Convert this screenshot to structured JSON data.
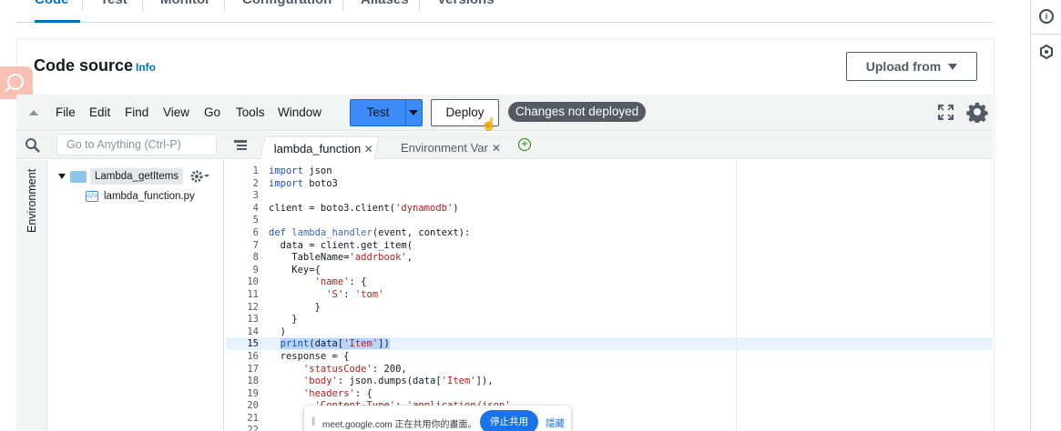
{
  "top_tabs": [
    "Code",
    "Test",
    "Monitor",
    "Configuration",
    "Aliases",
    "Versions"
  ],
  "header": {
    "title": "Code source",
    "info_link": "Info",
    "upload_label": "Upload from"
  },
  "ide": {
    "menu": [
      "File",
      "Edit",
      "Find",
      "View",
      "Go",
      "Tools",
      "Window"
    ],
    "test_label": "Test",
    "deploy_label": "Deploy",
    "status_badge": "Changes not deployed",
    "go_to_placeholder": "Go to Anything (Ctrl-P)",
    "environment_label": "Environment",
    "folder_name": "Lambda_getItems",
    "file_name": "lambda_function.py",
    "tabs": [
      {
        "label": "lambda_function",
        "active": true
      },
      {
        "label": "Environment Var",
        "active": false
      }
    ],
    "active_line": 15
  },
  "code_lines": [
    "import json",
    "import boto3",
    "",
    "client = boto3.client('dynamodb')",
    "",
    "def lambda_handler(event, context):",
    "  data = client.get_item(",
    "    TableName='addrbook',",
    "    Key={",
    "        'name': {",
    "          'S': 'tom'",
    "        }",
    "    }",
    "  )",
    "  print(data['Item'])",
    "  response = {",
    "      'statusCode': 200,",
    "      'body': json.dumps(data['Item']),",
    "      'headers': {",
    "        'Content-Type': 'application/json',",
    "",
    ""
  ],
  "meet_bar": {
    "handle": "||",
    "message": "meet.google.com 正在共用你的畫面。",
    "stop_label": "停止共用",
    "hide_label": "隱藏"
  },
  "colors": {
    "accent": "#0073bb",
    "test_button": "#3d8bf6",
    "badge": "#545b64",
    "keyword": "#1c4fbf",
    "string": "#b5201e",
    "meet_button": "#1a73e8"
  },
  "icons": [
    "info-icon",
    "hexagon-icon",
    "search-icon",
    "gear-icon",
    "expand-icon",
    "folder-icon",
    "python-file-icon",
    "plus-icon"
  ]
}
